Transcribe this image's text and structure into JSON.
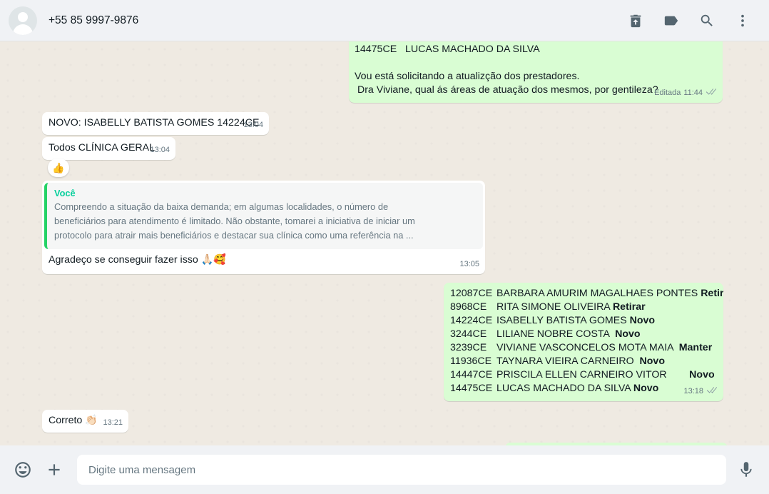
{
  "header": {
    "contact_name": "+55 85 9997-9876",
    "icons": [
      "delete-icon",
      "label-icon",
      "search-icon",
      "menu-icon"
    ]
  },
  "messages": {
    "m1": {
      "lines": [
        "14475CE   LUCAS MACHADO DA SILVA",
        "",
        "Vou está solicitando a atualizção dos prestadores.",
        " Dra Viviane, qual ás áreas de atuação dos mesmos, por gentileza?"
      ],
      "edited": "Editada",
      "time": "11:44"
    },
    "m2": {
      "text": "NOVO: ISABELLY BATISTA GOMES 14224CE",
      "time": "13:04"
    },
    "m3": {
      "text": "Todos CLÍNICA GERAL",
      "time": "13:04",
      "reaction": "👍"
    },
    "m4": {
      "quote_author": "Você",
      "quote_lines": [
        "Compreendo a situação da baixa demanda; em algumas localidades, o número de",
        "beneficiários para atendimento é limitado. Não obstante, tomarei a iniciativa de iniciar um",
        "protocolo para atrair mais beneficiários e destacar sua clínica como uma referência na ..."
      ],
      "text": "Agradeço se conseguir fazer isso 🙏🏻🥰",
      "time": "13:05"
    },
    "m5": {
      "rows": [
        {
          "code": "12087CE",
          "name": "BARBARA AMURIM MAGALHAES PONTES ",
          "status": "Retirar"
        },
        {
          "code": "8968CE",
          "name": "RITA SIMONE OLIVEIRA ",
          "status": "Retirar"
        },
        {
          "code": "14224CE",
          "name": "ISABELLY BATISTA GOMES ",
          "status": "Novo"
        },
        {
          "code": "3244CE",
          "name": "LILIANE NOBRE COSTA  ",
          "status": "Novo"
        },
        {
          "code": "3239CE",
          "name": "VIVIANE VASCONCELOS MOTA MAIA  ",
          "status": "Manter"
        },
        {
          "code": "11936CE",
          "name": "TAYNARA VIEIRA CARNEIRO  ",
          "status": "Novo"
        },
        {
          "code": "14447CE",
          "name": "PRISCILA ELLEN CARNEIRO VITOR        ",
          "status": "Novo"
        },
        {
          "code": "14475CE",
          "name": "LUCAS MACHADO DA SILVA ",
          "status": "Novo"
        }
      ],
      "time": "13:18"
    },
    "m6": {
      "text": "Correto 👏🏻",
      "time": "13:21"
    }
  },
  "footer": {
    "placeholder": "Digite uma mensagem",
    "icons": [
      "emoji-icon",
      "plus-icon",
      "mic-icon"
    ]
  }
}
